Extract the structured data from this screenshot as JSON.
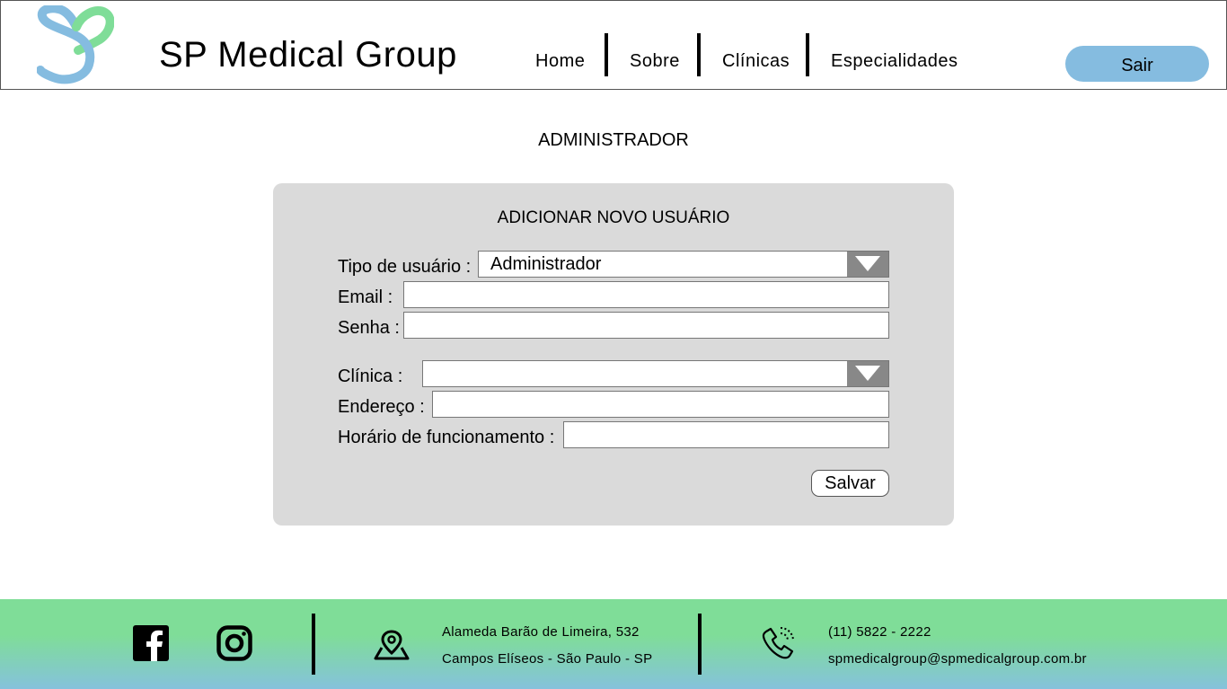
{
  "header": {
    "brand": "SP Medical Group",
    "logo_icon": "sp-heart-logo",
    "nav": [
      "Home",
      "Sobre",
      "Clínicas",
      "Especialidades"
    ],
    "logout_label": "Sair",
    "colors": {
      "logo_blue": "#85bce0",
      "logo_green": "#7fdd98",
      "logout_bg": "#85bce0"
    }
  },
  "main": {
    "title": "ADMINISTRADOR",
    "form": {
      "title": "ADICIONAR NOVO USUÁRIO",
      "user_type_label": "Tipo de usuário :",
      "user_type_value": "Administrador",
      "email_label": "Email :",
      "email_value": "",
      "password_label": "Senha :",
      "password_value": "",
      "clinic_label": "Clínica :",
      "clinic_value": "",
      "address_label": "Endereço :",
      "address_value": "",
      "hours_label": "Horário de funcionamento :",
      "hours_value": "",
      "save_label": "Salvar",
      "colors": {
        "card_bg": "#dadada",
        "dropdown_arrow_bg": "#888888"
      }
    }
  },
  "footer": {
    "icons": [
      "facebook-icon",
      "instagram-icon",
      "map-pin-icon",
      "phone-icon"
    ],
    "address_line1": "Alameda Barão de Limeira, 532",
    "address_line2": "Campos Elíseos - São Paulo - SP",
    "phone": "(11) 5822 - 2222",
    "email": "spmedicalgroup@spmedicalgroup.com.br",
    "colors": {
      "gradient_top": "#7fdd98",
      "gradient_bottom": "#85c2dc"
    }
  }
}
